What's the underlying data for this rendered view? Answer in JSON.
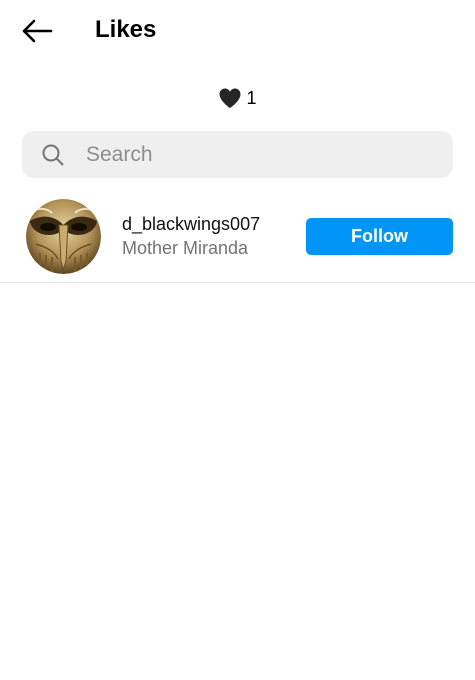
{
  "header": {
    "title": "Likes",
    "back_icon": "arrow-left-icon"
  },
  "likes": {
    "icon": "heart-icon",
    "count": "1"
  },
  "search": {
    "icon": "search-icon",
    "placeholder": "Search",
    "value": ""
  },
  "users": [
    {
      "username": "d_blackwings007",
      "full_name": "Mother Miranda",
      "avatar": "golden-mask-avatar",
      "action_label": "Follow"
    }
  ],
  "colors": {
    "follow_button": "#0095f6",
    "search_background": "#efefef",
    "secondary_text": "#737373"
  }
}
